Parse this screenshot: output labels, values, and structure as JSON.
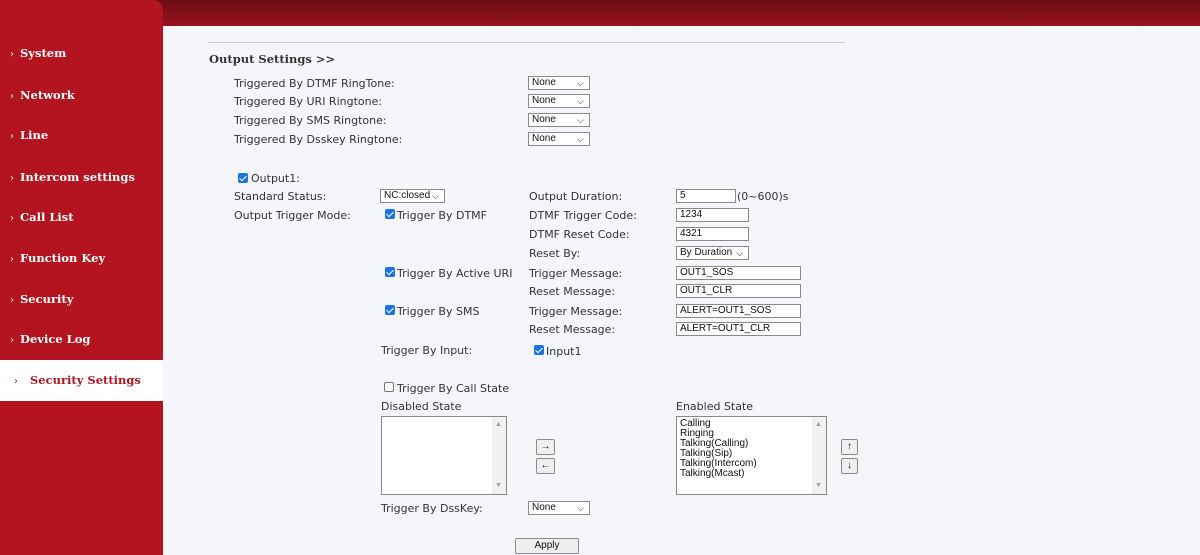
{
  "sidebar": {
    "items": [
      {
        "label": "System"
      },
      {
        "label": "Network"
      },
      {
        "label": "Line"
      },
      {
        "label": "Intercom settings"
      },
      {
        "label": "Call List"
      },
      {
        "label": "Function Key"
      },
      {
        "label": "Security"
      },
      {
        "label": "Device Log"
      },
      {
        "label": "Security Settings",
        "active": true
      }
    ]
  },
  "output": {
    "heading": "Output Settings >>",
    "ringtone_rows": [
      {
        "label": "Triggered By DTMF RingTone:",
        "value": "None"
      },
      {
        "label": "Triggered By URI Ringtone:",
        "value": "None"
      },
      {
        "label": "Triggered By SMS Ringtone:",
        "value": "None"
      },
      {
        "label": "Triggered By Dsskey Ringtone:",
        "value": "None"
      }
    ],
    "output1_label": "Output1:",
    "standard_status_label": "Standard Status:",
    "standard_status_value": "NC:closed",
    "output_duration_label": "Output Duration:",
    "output_duration_value": "5",
    "output_duration_range": "(0~600)s",
    "trigger_mode_label": "Output Trigger Mode:",
    "trigger_by_dtmf": "Trigger By DTMF",
    "dtmf_trigger_code_label": "DTMF Trigger Code:",
    "dtmf_trigger_code_value": "1234",
    "dtmf_reset_code_label": "DTMF Reset Code:",
    "dtmf_reset_code_value": "4321",
    "reset_by_label": "Reset By:",
    "reset_by_value": "By Duration",
    "trigger_by_uri": "Trigger By Active URI",
    "uri_trigger_msg_label": "Trigger Message:",
    "uri_trigger_msg_value": "OUT1_SOS",
    "uri_reset_msg_label": "Reset Message:",
    "uri_reset_msg_value": "OUT1_CLR",
    "trigger_by_sms": "Trigger By SMS",
    "sms_trigger_msg_label": "Trigger Message:",
    "sms_trigger_msg_value": "ALERT=OUT1_SOS",
    "sms_reset_msg_label": "Reset Message:",
    "sms_reset_msg_value": "ALERT=OUT1_CLR",
    "trigger_by_input_label": "Trigger By Input:",
    "input1_label": "Input1",
    "trigger_by_call_state": "Trigger By Call State",
    "disabled_state_label": "Disabled State",
    "enabled_state_label": "Enabled State",
    "enabled_states": [
      "Calling",
      "Ringing",
      "Talking(Calling)",
      "Talking(Sip)",
      "Talking(Intercom)",
      "Talking(Mcast)"
    ],
    "move_right": "→",
    "move_left": "←",
    "move_up": "↑",
    "move_down": "↓",
    "trigger_by_dsskey_label": "Trigger By DssKey:",
    "trigger_by_dsskey_value": "None",
    "apply_label": "Apply"
  }
}
